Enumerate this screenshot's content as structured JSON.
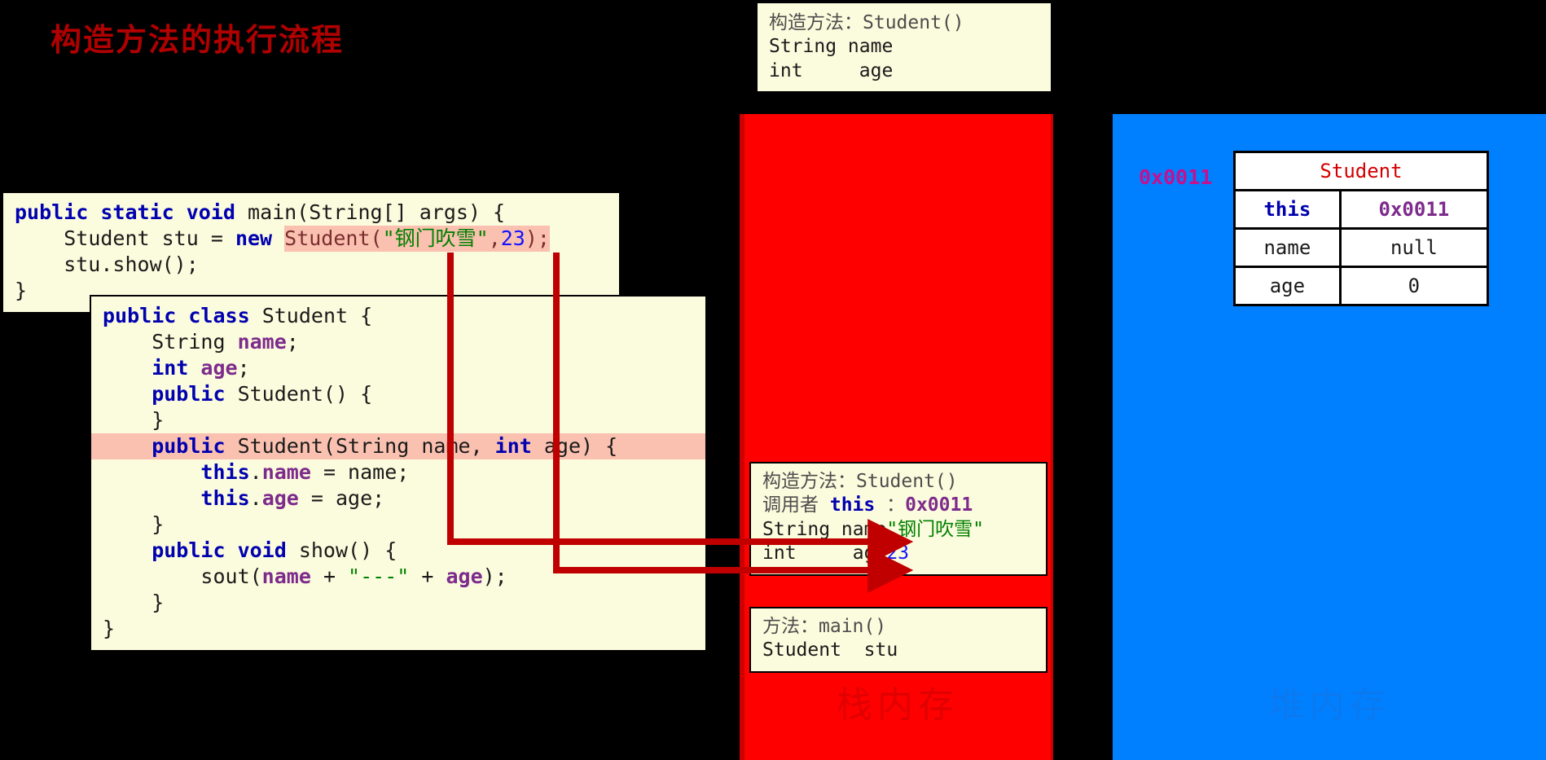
{
  "title": "构造方法的执行流程",
  "colors": {
    "title": "#b00000",
    "stack_panel": "#ff0000",
    "heap_panel": "#0080ff",
    "card_bg": "#fbfbdd",
    "highlight": "#fac0b0",
    "keyword": "#0000b0",
    "field": "#7d2b8c",
    "string": "#008000",
    "number": "#1414ff",
    "heap_addr": "#c5108f",
    "arrow": "#c00000"
  },
  "method_area": {
    "label": "构造方法：Student()",
    "lines": [
      "String name",
      "int     age"
    ]
  },
  "main_code": {
    "line1": {
      "kw1": "public",
      "kw2": "static",
      "kw3": "void",
      "rest": " main(String[] args) {"
    },
    "line2": {
      "indent": "    ",
      "decl": "Student stu = ",
      "kw_new": "new",
      "ctor": "Student(",
      "str_arg": "\"钢门吹雪\"",
      "comma": ",",
      "num_arg": "23",
      "tail": ");"
    },
    "line3": "    stu.show();",
    "line4": "}"
  },
  "student_code": {
    "l1_kw1": "public",
    "l1_kw2": "class",
    "l1_rest": " Student {",
    "l2_type": "    String ",
    "l2_field": "name",
    "l2_tail": ";",
    "l3_type": "    int",
    "l3_field": " age",
    "l3_tail": ";",
    "l4_kw": "    public",
    "l4_rest": " Student() {",
    "l5": "    }",
    "l6_kw": "    public",
    "l6_mid": " Student(String name, ",
    "l6_kw2": "int",
    "l6_tail": " age) {",
    "l7_this": "        this",
    "l7_dot": ".",
    "l7_field": "name",
    "l7_tail": " = name;",
    "l8_this": "        this",
    "l8_dot": ".",
    "l8_field": "age",
    "l8_tail": " = age;",
    "l9": "    }",
    "l10_kw1": "    public",
    "l10_kw2": " void",
    "l10_rest": " show() {",
    "l11_pre": "        sout(",
    "l11_f1": "name",
    "l11_plus1": " + ",
    "l11_str": "\"---\"",
    "l11_plus2": " + ",
    "l11_f2": "age",
    "l11_tail": ");",
    "l12": "    }",
    "l13": "}"
  },
  "stack": {
    "watermark": "栈内存",
    "frame_ctor": {
      "title": "构造方法：Student()",
      "caller_label": "调用者 ",
      "caller_this": "this",
      "caller_sep": " ：",
      "caller_addr": "0x0011",
      "row_name_type": "String name",
      "row_name_value": "\"钢门吹雪\"",
      "row_age_type": "int     age",
      "row_age_value": "23"
    },
    "frame_main": {
      "title": "方法：main()",
      "line1": "Student  stu"
    }
  },
  "heap": {
    "watermark": "堆内存",
    "address": "0x0011",
    "object": {
      "header": "Student",
      "rows": [
        {
          "key": "this",
          "value": "0x0011"
        },
        {
          "key": "name",
          "value": "null"
        },
        {
          "key": "age",
          "value": "0"
        }
      ]
    }
  }
}
